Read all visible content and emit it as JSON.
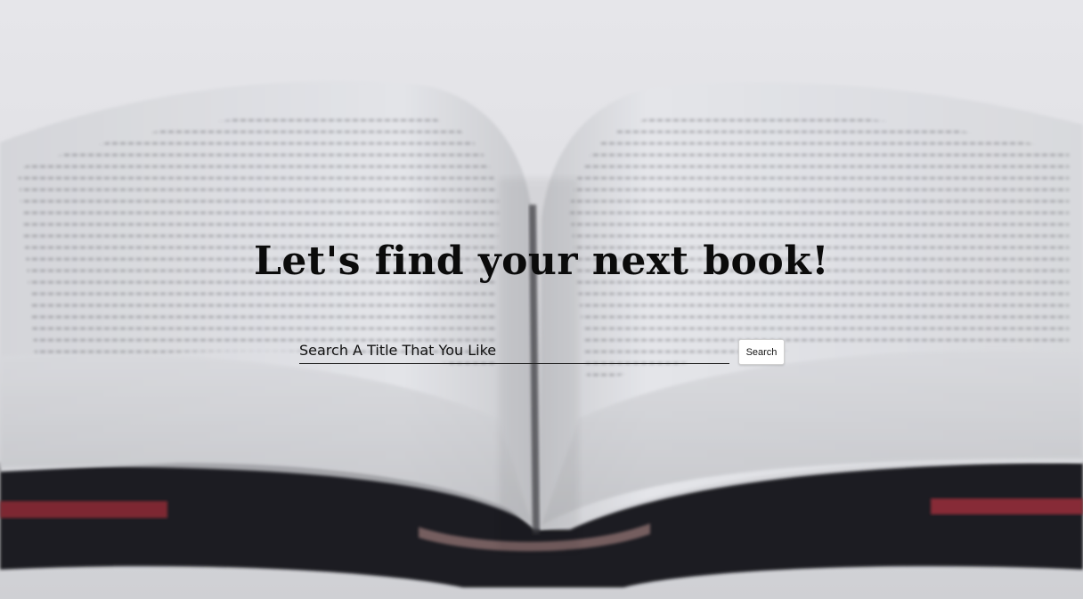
{
  "hero": {
    "headline": "Let's find your next book!",
    "background": "open-book-photo"
  },
  "search": {
    "placeholder": "Search A Title That You Like",
    "value": "",
    "button_label": "Search"
  },
  "colors": {
    "page_background": "#e4e4e8",
    "book_pages": "#d9dade",
    "book_cover": "#1b1c20",
    "cover_accent": "#8e2a34",
    "text": "#0b0b0b"
  }
}
